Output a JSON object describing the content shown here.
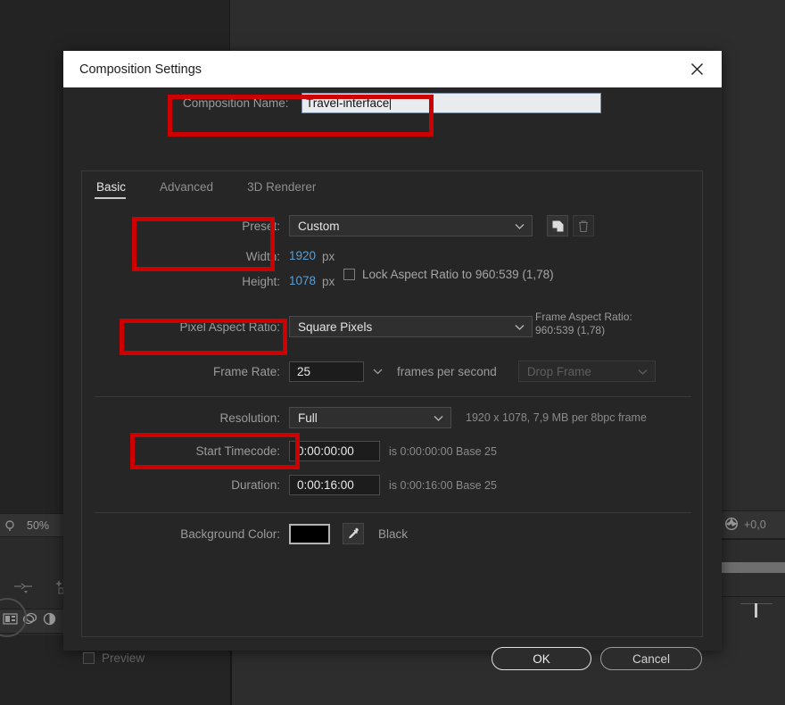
{
  "window": {
    "title": "Composition Settings",
    "close_icon": "close-icon"
  },
  "composition_name": {
    "label": "Composition Name:",
    "value": "Travel-interface",
    "placeholder": "Composition Name"
  },
  "tabs": [
    {
      "label": "Basic",
      "active": true
    },
    {
      "label": "Advanced",
      "active": false
    },
    {
      "label": "3D Renderer",
      "active": false
    }
  ],
  "preset": {
    "label": "Preset:",
    "value": "Custom",
    "save_icon": "save-preset-icon",
    "delete_icon": "trash-icon"
  },
  "width": {
    "label": "Width:",
    "value": "1920",
    "unit": "px"
  },
  "height": {
    "label": "Height:",
    "value": "1078",
    "unit": "px"
  },
  "lock_aspect": {
    "label": "Lock Aspect Ratio to 960:539 (1,78)",
    "checked": false
  },
  "pixel_aspect_ratio": {
    "label": "Pixel Aspect Ratio:",
    "value": "Square Pixels"
  },
  "frame_aspect_ratio": {
    "label": "Frame Aspect Ratio:",
    "value": "960:539 (1,78)"
  },
  "frame_rate": {
    "label": "Frame Rate:",
    "value": "25",
    "suffix": "frames per second",
    "drop_frame": "Drop Frame"
  },
  "resolution": {
    "label": "Resolution:",
    "value": "Full",
    "info": "1920 x 1078, 7,9 MB per 8bpc frame"
  },
  "start_timecode": {
    "label": "Start Timecode:",
    "value": "0:00:00:00",
    "info": "is 0:00:00:00  Base 25"
  },
  "duration": {
    "label": "Duration:",
    "value": "0:00:16:00",
    "info": "is 0:00:16:00  Base 25"
  },
  "background_color": {
    "label": "Background Color:",
    "swatch_hex": "#000000",
    "eyedropper_icon": "eyedropper-icon",
    "name": "Black"
  },
  "footer": {
    "preview_label": "Preview",
    "preview_checked": false,
    "ok_label": "OK",
    "cancel_label": "Cancel"
  },
  "background_app": {
    "zoom_level": "50%",
    "shutter_value": "+0,0"
  },
  "annotations": {
    "color": "#cc0000",
    "boxes": [
      "composition-name",
      "width-height",
      "frame-rate",
      "duration"
    ]
  }
}
